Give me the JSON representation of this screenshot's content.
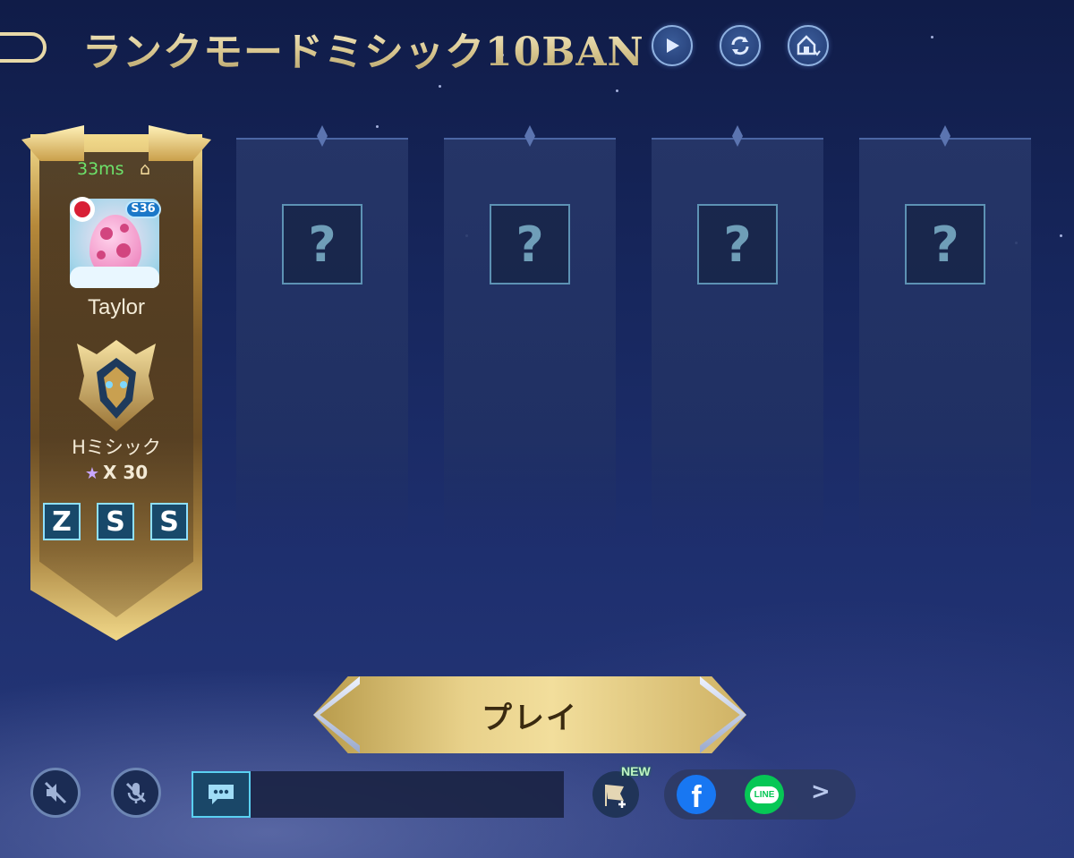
{
  "header": {
    "title": "ランクモードミシック10BAN",
    "icons": [
      "play-icon",
      "refresh-icon",
      "home-icon"
    ]
  },
  "player": {
    "ping": "33ms",
    "season_badge": "S36",
    "name": "Taylor",
    "rank_name": "Hミシック",
    "rank_stars": "X 30",
    "spells": [
      "Z",
      "S",
      "S"
    ]
  },
  "slots": [
    {
      "placeholder": "?"
    },
    {
      "placeholder": "?"
    },
    {
      "placeholder": "?"
    },
    {
      "placeholder": "?"
    }
  ],
  "play_button": {
    "label": "プレイ"
  },
  "bottom_bar": {
    "new_badge": "NEW",
    "facebook": "f",
    "line": "LINE",
    "more": ">"
  },
  "colors": {
    "accent_gold": "#e8d18a",
    "ping_green": "#6de26a",
    "facebook": "#1877f2",
    "line": "#06c755"
  }
}
